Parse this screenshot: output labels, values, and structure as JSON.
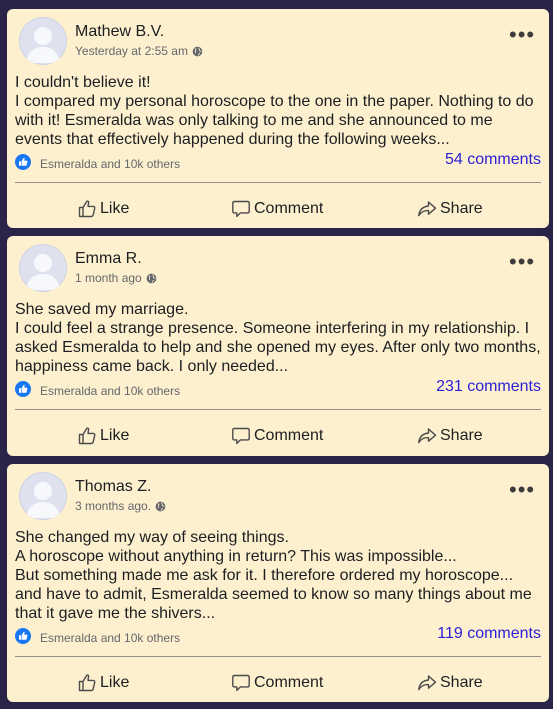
{
  "posts": [
    {
      "author": "Mathew B.V.",
      "time": "Yesterday at 2:55 am",
      "text": "I couldn't believe it!\nI compared my personal horoscope to the one in the paper. Nothing to do with it! Esmeralda was only talking to me and she announced to me events that effectively happened during the following weeks...",
      "likers": "Esmeralda and 10k others",
      "comments": "54 comments"
    },
    {
      "author": "Emma R.",
      "time": "1 month ago",
      "text": "She saved my marriage.\nI could feel a strange presence. Someone interfering in my relationship. I asked Esmeralda to help and she opened my eyes. After only two months, happiness came back. I only needed...",
      "likers": "Esmeralda and 10k others",
      "comments": "231 comments"
    },
    {
      "author": "Thomas Z.",
      "time": "3 months ago.",
      "text": "She changed my way of seeing things.\nA horoscope without anything in return? This was impossible...\nBut something made me ask for it. I therefore ordered my horoscope... and have to admit, Esmeralda seemed to know so many things about me that it gave me the shivers...",
      "likers": "Esmeralda and 10k others",
      "comments": "119 comments"
    }
  ],
  "actions": {
    "like": "Like",
    "comment": "Comment",
    "share": "Share"
  },
  "icons": {
    "avatar": "default-avatar-icon",
    "privacy": "globe-icon",
    "more": "more-options-icon",
    "reaction": "thumbs-up-badge-icon",
    "like": "thumbs-up-icon",
    "comment": "speech-bubble-icon",
    "share": "share-arrow-icon"
  },
  "colors": {
    "background": "#2a2548",
    "card": "#fdf0cf",
    "link": "#2a1fd6",
    "reaction": "#1877f2"
  }
}
